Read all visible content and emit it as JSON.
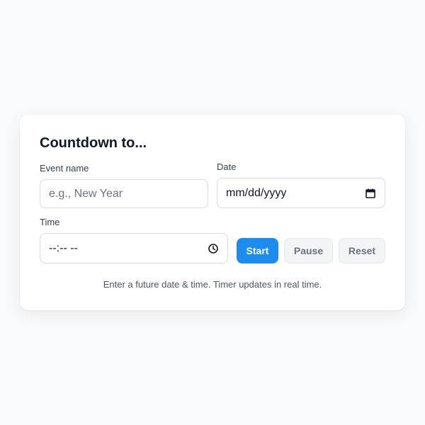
{
  "card": {
    "title": "Countdown to..."
  },
  "form": {
    "event_name": {
      "label": "Event name",
      "placeholder": "e.g., New Year"
    },
    "date": {
      "label": "Date",
      "placeholder": "mm/dd/yyyy",
      "icon": "calendar-icon"
    },
    "time": {
      "label": "Time",
      "placeholder": "--:-- --",
      "icon": "clock-icon"
    }
  },
  "buttons": {
    "start_label": "Start",
    "pause_label": "Pause",
    "reset_label": "Reset"
  },
  "hint": "Enter a future date & time. Timer updates in real time.",
  "colors": {
    "background": "#f9fafb",
    "card": "#ffffff",
    "primary": "#1d8cef",
    "secondary_button": "#f3f4f6",
    "border": "#d7dce3"
  }
}
